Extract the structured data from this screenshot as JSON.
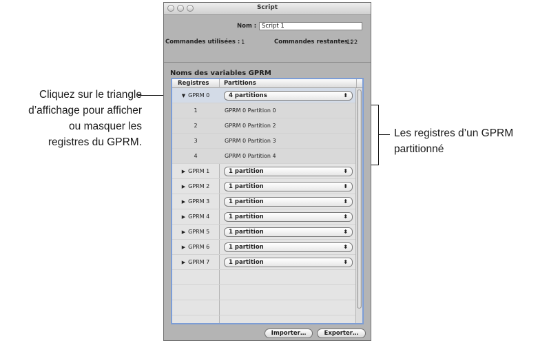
{
  "callouts": {
    "left_lines": [
      "Cliquez sur le triangle",
      "d’affichage pour afficher",
      "ou masquer les",
      "registres du GPRM."
    ],
    "right_lines": [
      "Les registres d’un GPRM",
      "partitionné"
    ]
  },
  "window": {
    "title": "Script",
    "name_label": "Nom :",
    "name_value": "Script 1",
    "used_label": "Commandes utilisées :",
    "used_value": "1",
    "remaining_label": "Commandes restantes :",
    "remaining_value": "122"
  },
  "section": {
    "title": "Noms des variables GPRM"
  },
  "table": {
    "headers": {
      "registers": "Registres",
      "partitions": "Partitions"
    },
    "expanded": {
      "register": "GPRM 0",
      "partitions": "4 partitions"
    },
    "sub_rows": [
      {
        "number": "1",
        "label": "GPRM 0 Partition 0"
      },
      {
        "number": "2",
        "label": "GPRM 0 Partition 2"
      },
      {
        "number": "3",
        "label": "GPRM 0 Partition 3"
      },
      {
        "number": "4",
        "label": "GPRM 0 Partition 4"
      }
    ],
    "collapsed": [
      {
        "register": "GPRM 1",
        "partitions": "1 partition"
      },
      {
        "register": "GPRM 2",
        "partitions": "1 partition"
      },
      {
        "register": "GPRM 3",
        "partitions": "1 partition"
      },
      {
        "register": "GPRM 4",
        "partitions": "1 partition"
      },
      {
        "register": "GPRM 5",
        "partitions": "1 partition"
      },
      {
        "register": "GPRM 6",
        "partitions": "1 partition"
      },
      {
        "register": "GPRM 7",
        "partitions": "1 partition"
      }
    ],
    "popup_arrows": "⬍"
  },
  "buttons": {
    "import": "Importer…",
    "export": "Exporter…"
  },
  "colors": {
    "selection_border": "#7c9dd6",
    "selected_row": "#d3dbe7",
    "window_bg": "#b4b4b4"
  }
}
